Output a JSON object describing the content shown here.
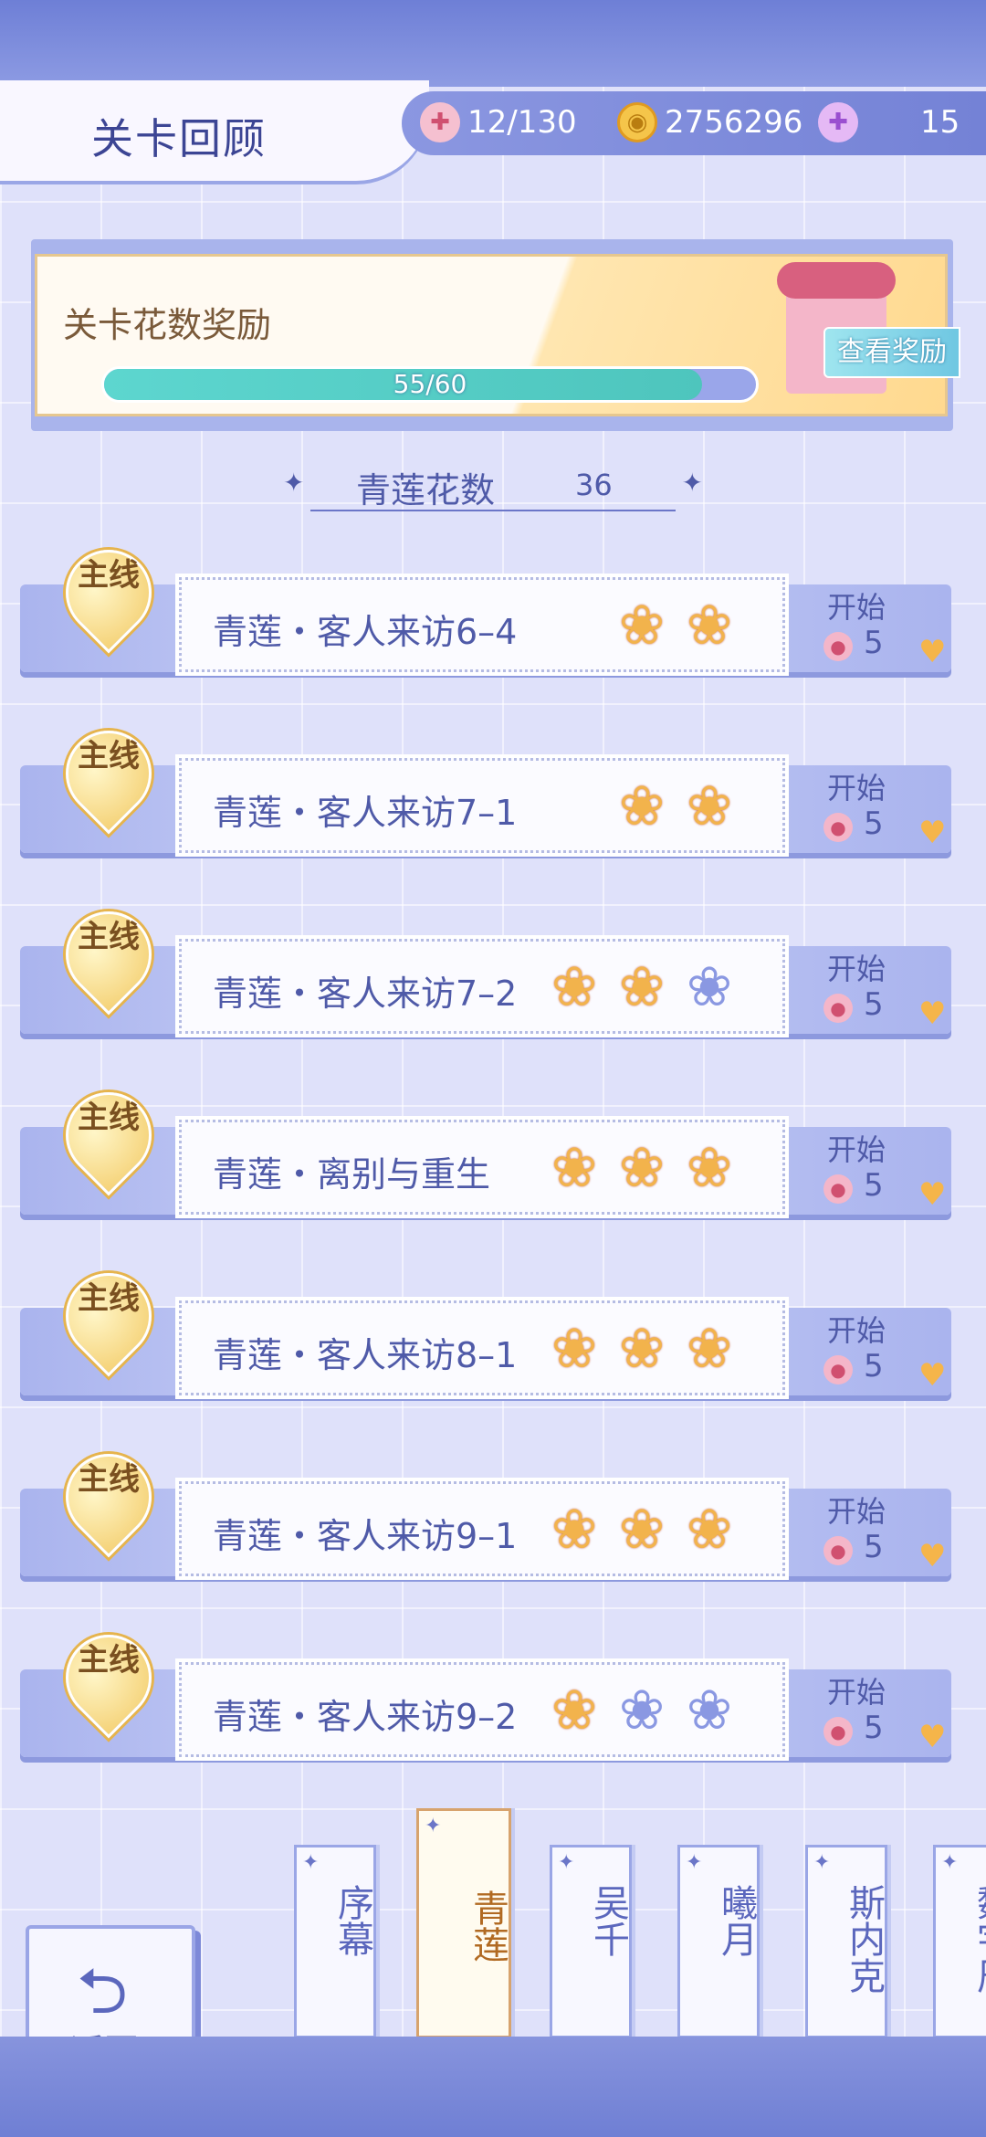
{
  "header": {
    "title": "关卡回顾",
    "stamina": "12/130",
    "coins": "2756296",
    "gems": "15"
  },
  "reward": {
    "title": "关卡花数奖励",
    "progress_text": "55/60",
    "progress_fraction": 0.917,
    "view_button": "查看奖励"
  },
  "flower_count": {
    "label": "青莲花数",
    "value": "36"
  },
  "levels": [
    {
      "tag": "主线",
      "name": "青莲・客人来访6–4",
      "flowers_earned": 2,
      "flowers_total": 2,
      "start": "开始",
      "cost": "5"
    },
    {
      "tag": "主线",
      "name": "青莲・客人来访7–1",
      "flowers_earned": 2,
      "flowers_total": 2,
      "start": "开始",
      "cost": "5"
    },
    {
      "tag": "主线",
      "name": "青莲・客人来访7–2",
      "flowers_earned": 2,
      "flowers_total": 3,
      "start": "开始",
      "cost": "5"
    },
    {
      "tag": "主线",
      "name": "青莲・离别与重生",
      "flowers_earned": 3,
      "flowers_total": 3,
      "start": "开始",
      "cost": "5"
    },
    {
      "tag": "主线",
      "name": "青莲・客人来访8–1",
      "flowers_earned": 3,
      "flowers_total": 3,
      "start": "开始",
      "cost": "5"
    },
    {
      "tag": "主线",
      "name": "青莲・客人来访9–1",
      "flowers_earned": 3,
      "flowers_total": 3,
      "start": "开始",
      "cost": "5"
    },
    {
      "tag": "主线",
      "name": "青莲・客人来访9–2",
      "flowers_earned": 1,
      "flowers_total": 3,
      "start": "开始",
      "cost": "5"
    }
  ],
  "back_button": "返回",
  "tabs": [
    {
      "label": "序幕",
      "active": false
    },
    {
      "label": "青莲",
      "active": true
    },
    {
      "label": "吴千",
      "active": false
    },
    {
      "label": "曦月",
      "active": false
    },
    {
      "label": "斯内克",
      "active": false
    },
    {
      "label": "魏宇辰",
      "active": false
    }
  ],
  "colors": {
    "accent": "#4f5aa8",
    "flower_on": "#f2b34c",
    "flower_off": "#8a98e2",
    "progress": "#5dd6cf"
  }
}
